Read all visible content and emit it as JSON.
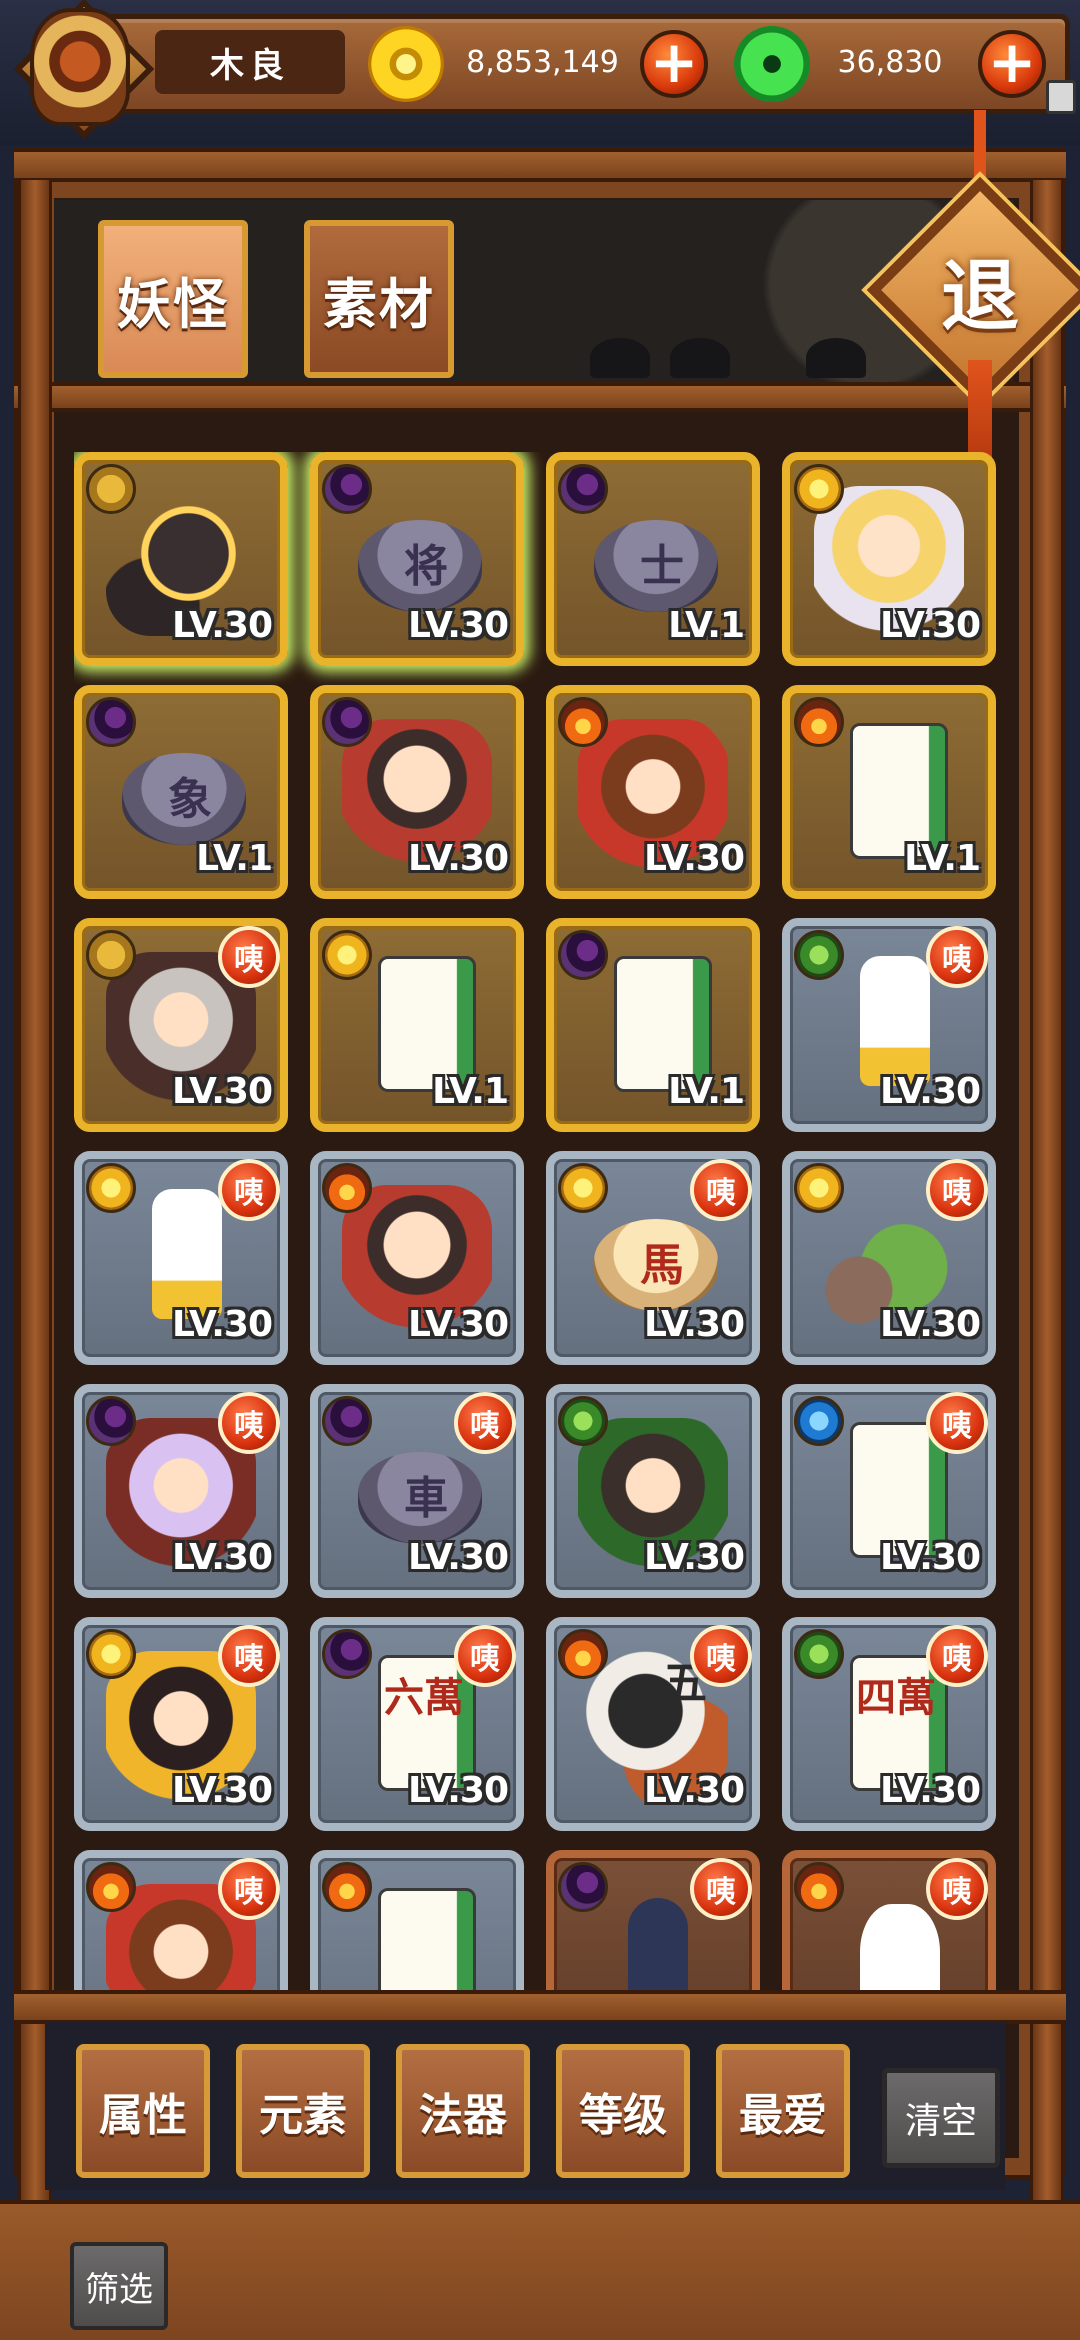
{
  "header": {
    "player_name": "木良",
    "coins": "8,853,149",
    "jade": "36,830",
    "plus_symbol": "+"
  },
  "tabs": [
    {
      "label": "妖怪",
      "active": true
    },
    {
      "label": "素材",
      "active": false
    }
  ],
  "exit_label": "退",
  "cards": [
    {
      "frame": "gold",
      "element": "mountain",
      "portrait": "wolf",
      "glyph": "",
      "level": "LV.30",
      "badge": "",
      "glow": true
    },
    {
      "frame": "gold",
      "element": "moon",
      "portrait": "chess",
      "glyph": "将",
      "level": "LV.30",
      "badge": "",
      "glow": true
    },
    {
      "frame": "gold",
      "element": "moon",
      "portrait": "chess",
      "glyph": "士",
      "level": "LV.1",
      "badge": "",
      "glow": false
    },
    {
      "frame": "gold",
      "element": "sun",
      "portrait": "char-b",
      "glyph": "",
      "level": "LV.30",
      "badge": "",
      "glow": false
    },
    {
      "frame": "gold",
      "element": "moon",
      "portrait": "chess",
      "glyph": "象",
      "level": "LV.1",
      "badge": "",
      "glow": false
    },
    {
      "frame": "gold",
      "element": "moon",
      "portrait": "char-a",
      "glyph": "",
      "level": "LV.30",
      "badge": "",
      "glow": false
    },
    {
      "frame": "gold",
      "element": "fire",
      "portrait": "char-g",
      "glyph": "",
      "level": "LV.30",
      "badge": "",
      "glow": false
    },
    {
      "frame": "gold",
      "element": "fire",
      "portrait": "tile",
      "glyph": "",
      "level": "LV.1",
      "badge": "",
      "glow": false
    },
    {
      "frame": "gold",
      "element": "mountain",
      "portrait": "char-c",
      "glyph": "",
      "level": "LV.30",
      "badge": "咦",
      "glow": false
    },
    {
      "frame": "gold",
      "element": "sun",
      "portrait": "tile",
      "glyph": "",
      "level": "LV.1",
      "badge": "",
      "glow": false
    },
    {
      "frame": "gold",
      "element": "moon",
      "portrait": "tile",
      "glyph": "",
      "level": "LV.1",
      "badge": "",
      "glow": false
    },
    {
      "frame": "silver",
      "element": "leaf",
      "portrait": "rook",
      "glyph": "",
      "level": "LV.30",
      "badge": "咦",
      "glow": false
    },
    {
      "frame": "silver",
      "element": "sun",
      "portrait": "rook",
      "glyph": "",
      "level": "LV.30",
      "badge": "咦",
      "glow": false
    },
    {
      "frame": "silver",
      "element": "fire",
      "portrait": "char-a",
      "glyph": "",
      "level": "LV.30",
      "badge": "",
      "glow": false
    },
    {
      "frame": "silver",
      "element": "sun",
      "portrait": "chess-light",
      "glyph": "馬",
      "level": "LV.30",
      "badge": "咦",
      "glow": false
    },
    {
      "frame": "silver",
      "element": "sun",
      "portrait": "cart",
      "glyph": "",
      "level": "LV.30",
      "badge": "咦",
      "glow": false
    },
    {
      "frame": "silver",
      "element": "moon",
      "portrait": "char-e",
      "glyph": "",
      "level": "LV.30",
      "badge": "咦",
      "glow": false
    },
    {
      "frame": "silver",
      "element": "moon",
      "portrait": "chess",
      "glyph": "車",
      "level": "LV.30",
      "badge": "咦",
      "glow": false
    },
    {
      "frame": "silver",
      "element": "leaf",
      "portrait": "char-d",
      "glyph": "",
      "level": "LV.30",
      "badge": "",
      "glow": false
    },
    {
      "frame": "silver",
      "element": "water",
      "portrait": "tile",
      "glyph": "",
      "level": "LV.30",
      "badge": "咦",
      "glow": false
    },
    {
      "frame": "silver",
      "element": "sun",
      "portrait": "char-f",
      "glyph": "",
      "level": "LV.30",
      "badge": "咦",
      "glow": false
    },
    {
      "frame": "silver",
      "element": "moon",
      "portrait": "tile",
      "glyph": "六萬",
      "level": "LV.30",
      "badge": "咦",
      "glow": false
    },
    {
      "frame": "silver",
      "element": "fire",
      "portrait": "char-h",
      "glyph": "五",
      "level": "LV.30",
      "badge": "咦",
      "glow": false
    },
    {
      "frame": "silver",
      "element": "leaf",
      "portrait": "tile",
      "glyph": "四萬",
      "level": "LV.30",
      "badge": "咦",
      "glow": false
    },
    {
      "frame": "silver",
      "element": "fire",
      "portrait": "char-g",
      "glyph": "",
      "level": "",
      "badge": "咦",
      "glow": false
    },
    {
      "frame": "silver",
      "element": "fire",
      "portrait": "tile",
      "glyph": "",
      "level": "",
      "badge": "",
      "glow": false
    },
    {
      "frame": "bronze",
      "element": "moon",
      "portrait": "pawn-dark",
      "glyph": "",
      "level": "",
      "badge": "咦",
      "glow": false
    },
    {
      "frame": "bronze",
      "element": "fire",
      "portrait": "knight",
      "glyph": "",
      "level": "",
      "badge": "咦",
      "glow": false
    }
  ],
  "filters": [
    "属性",
    "元素",
    "法器",
    "等级",
    "最爱"
  ],
  "clear_label": "清空",
  "screen_label": "筛选",
  "colors": {
    "gold_frame": "#e9b32b",
    "silver_frame": "#a9b6c4",
    "bronze_frame": "#b5673a",
    "badge_red": "#d8320e"
  }
}
